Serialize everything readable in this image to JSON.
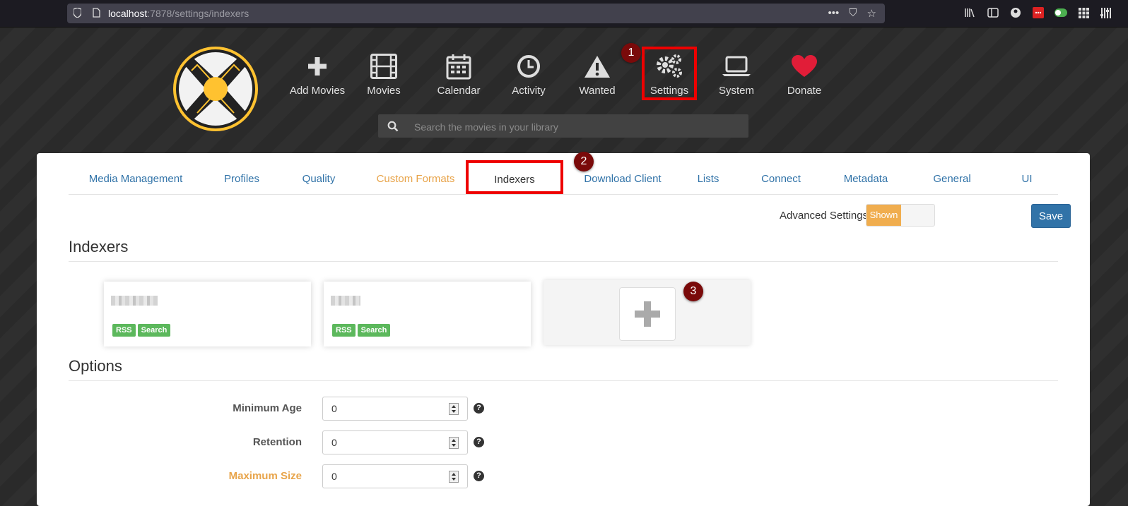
{
  "browser": {
    "url_host": "localhost",
    "url_path": ":7878/settings/indexers",
    "actions": [
      "•••",
      "⛉",
      "☆"
    ]
  },
  "nav": {
    "items": [
      {
        "label": "Add Movies",
        "icon": "plus-icon"
      },
      {
        "label": "Movies",
        "icon": "film-icon"
      },
      {
        "label": "Calendar",
        "icon": "calendar-icon"
      },
      {
        "label": "Activity",
        "icon": "clock-icon"
      },
      {
        "label": "Wanted",
        "icon": "warning-icon"
      },
      {
        "label": "Settings",
        "icon": "gears-icon"
      },
      {
        "label": "System",
        "icon": "laptop-icon"
      },
      {
        "label": "Donate",
        "icon": "heart-icon"
      }
    ],
    "search_placeholder": "Search the movies in your library"
  },
  "annotations": [
    "1",
    "2",
    "3"
  ],
  "tabs": [
    "Media Management",
    "Profiles",
    "Quality",
    "Custom Formats",
    "Indexers",
    "Download Client",
    "Lists",
    "Connect",
    "Metadata",
    "General",
    "UI"
  ],
  "advanced": {
    "label": "Advanced Settings",
    "toggle_on": "Shown"
  },
  "save_label": "Save",
  "indexers_section": {
    "title": "Indexers",
    "cards": [
      {
        "tags": [
          "RSS",
          "Search"
        ]
      },
      {
        "tags": [
          "RSS",
          "Search"
        ]
      }
    ]
  },
  "options_section": {
    "title": "Options",
    "fields": [
      {
        "label": "Minimum Age",
        "value": "0"
      },
      {
        "label": "Retention",
        "value": "0"
      },
      {
        "label": "Maximum Size",
        "value": "0"
      }
    ]
  },
  "colors": {
    "accent": "#3173a8",
    "warning": "#f0ad4e",
    "success": "#5cb85c",
    "highlight": "#ee0000",
    "annotation": "#7a0a0a"
  }
}
